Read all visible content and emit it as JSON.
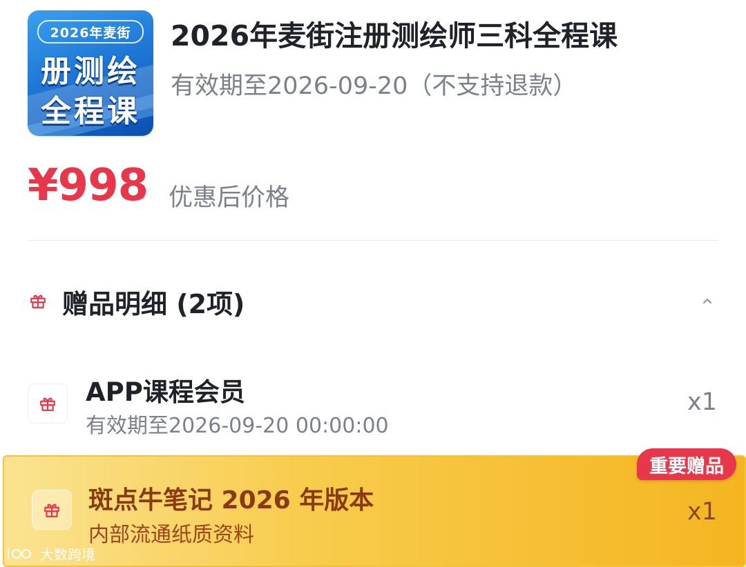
{
  "product": {
    "cover": {
      "tag": "2026年麦街",
      "line1": "册测绘",
      "line2": "全程课"
    },
    "title": "2026年麦街注册测绘师三科全程课",
    "validity": "有效期至2026-09-20（不支持退款）",
    "price": "¥998",
    "price_note": "优惠后价格"
  },
  "gifts": {
    "header": "赠品明细 (2项)",
    "items": [
      {
        "name": "APP课程会员",
        "sub": "有效期至2026-09-20 00:00:00",
        "qty": "x1"
      },
      {
        "name": "斑点牛笔记 2026 年版本",
        "sub": "内部流通纸质资料",
        "qty": "x1",
        "badge": "重要赠品"
      }
    ]
  },
  "watermark": "大数跨境",
  "icons": {
    "gift": "gift-icon",
    "collapse": "chevron-up-icon"
  },
  "colors": {
    "price": "#e8374a",
    "highlight_bg": "#f8cc4d",
    "badge": "#e8374a"
  }
}
